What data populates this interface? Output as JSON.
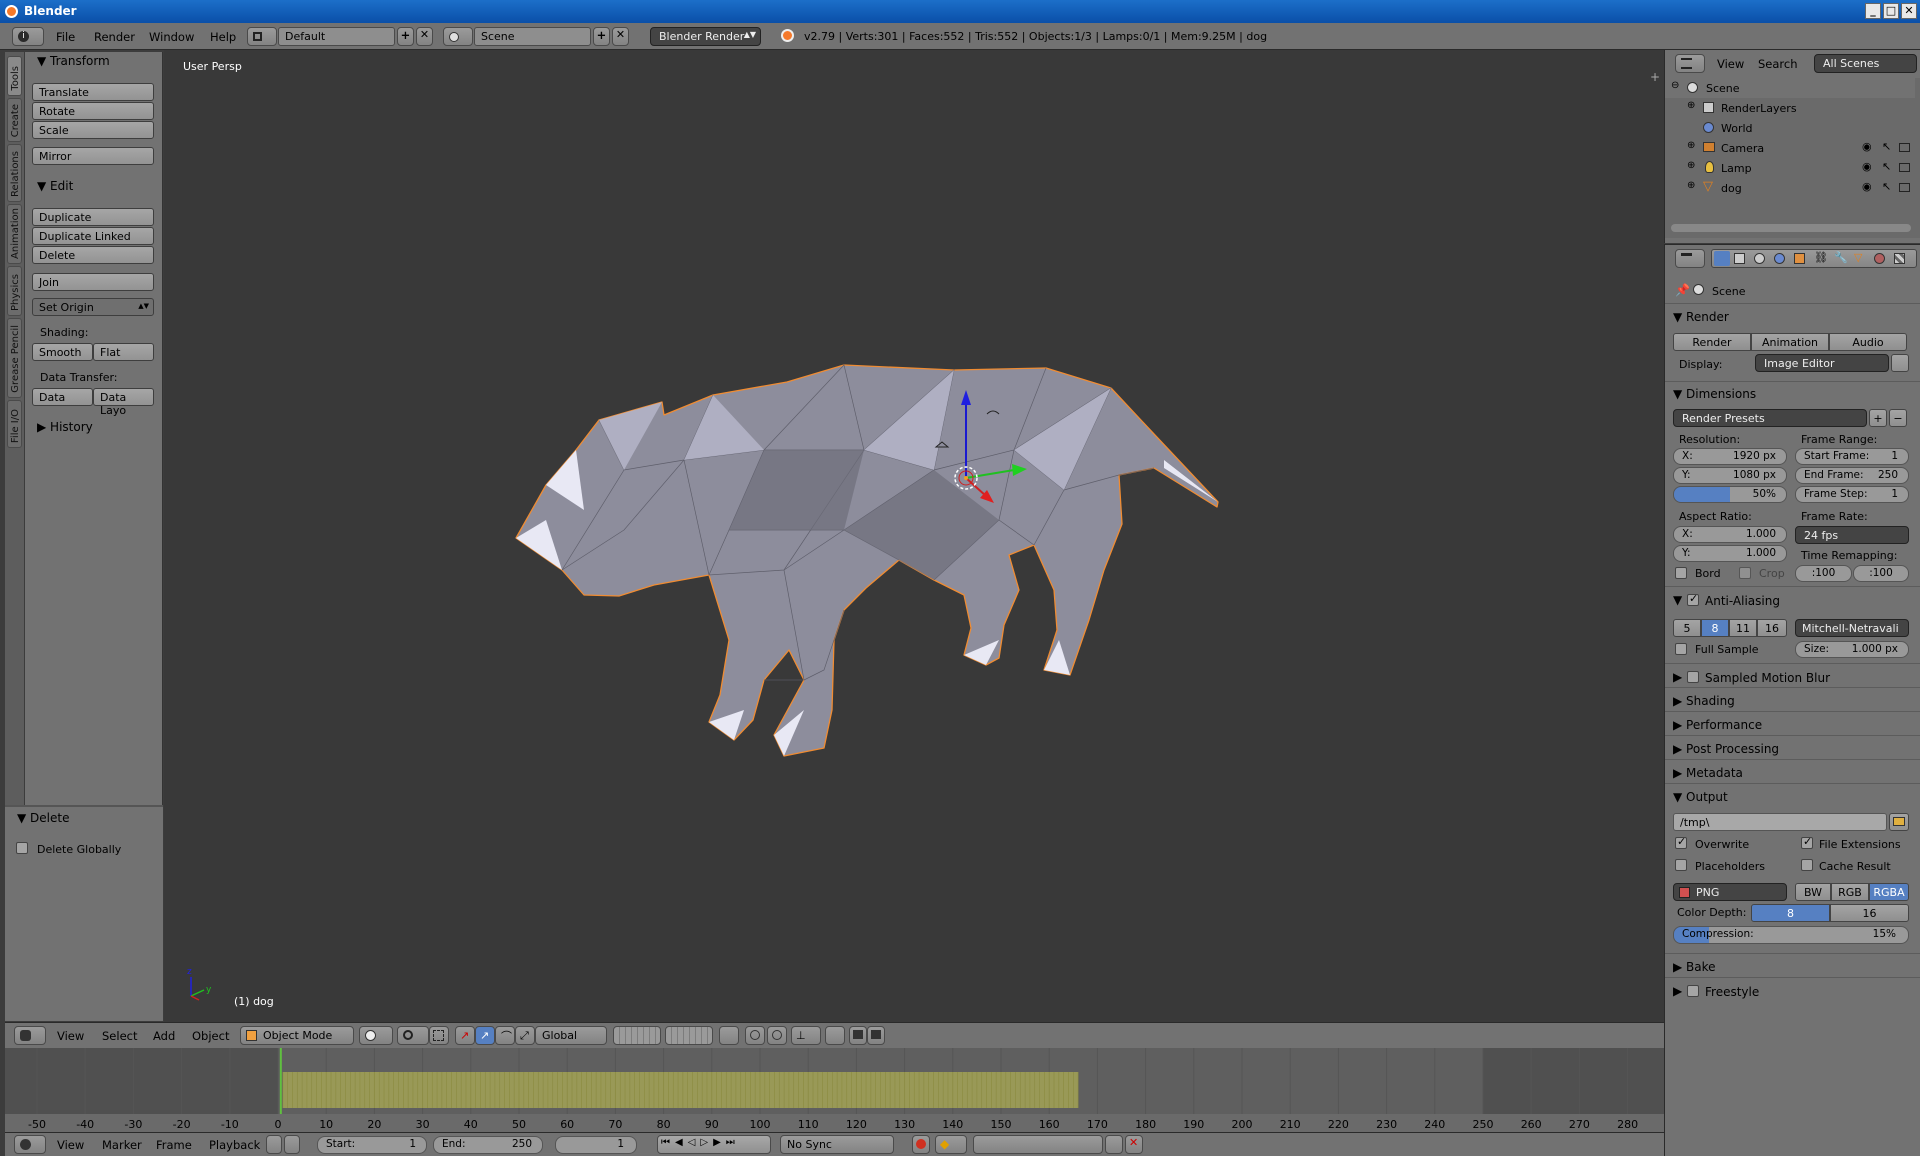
{
  "window": {
    "title": "Blender",
    "btn_min": "_",
    "btn_max": "□",
    "btn_close": "✕"
  },
  "info_header": {
    "menus": [
      "File",
      "Render",
      "Window",
      "Help"
    ],
    "layout": "Default",
    "scene": "Scene",
    "engine": "Blender Render",
    "stats": "v2.79 | Verts:301 | Faces:552 | Tris:552 | Objects:1/3 | Lamps:0/1 | Mem:9.25M | dog"
  },
  "tool_tabs": [
    "Tools",
    "Create",
    "Relations",
    "Animation",
    "Physics",
    "Grease Pencil",
    "File I/O"
  ],
  "tool_shelf": {
    "transform_title": "Transform",
    "translate": "Translate",
    "rotate": "Rotate",
    "scale": "Scale",
    "mirror": "Mirror",
    "edit_title": "Edit",
    "duplicate": "Duplicate",
    "duplicate_linked": "Duplicate Linked",
    "delete": "Delete",
    "join": "Join",
    "set_origin": "Set Origin",
    "shading_label": "Shading:",
    "smooth": "Smooth",
    "flat": "Flat",
    "data_transfer_label": "Data Transfer:",
    "data": "Data",
    "data_layout": "Data Layo",
    "history_title": "History"
  },
  "operator_panel": {
    "title": "Delete",
    "delete_globally": "Delete Globally"
  },
  "viewport": {
    "view_label": "User Persp",
    "object_label": "(1) dog"
  },
  "view3d_header": {
    "menus": [
      "View",
      "Select",
      "Add",
      "Object"
    ],
    "mode": "Object Mode",
    "orientation": "Global"
  },
  "timeline": {
    "ticks": [
      "-50",
      "-40",
      "-30",
      "-20",
      "-10",
      "0",
      "10",
      "20",
      "30",
      "40",
      "50",
      "60",
      "70",
      "80",
      "90",
      "100",
      "110",
      "120",
      "130",
      "140",
      "150",
      "160",
      "170",
      "180",
      "190",
      "200",
      "210",
      "220",
      "230",
      "240",
      "250",
      "260",
      "270",
      "280"
    ],
    "menus": [
      "View",
      "Marker",
      "Frame",
      "Playback"
    ],
    "start_label": "Start:",
    "start_value": "1",
    "end_label": "End:",
    "end_value": "250",
    "current_frame": "1",
    "sync": "No Sync"
  },
  "outliner": {
    "menus": [
      "View",
      "Search"
    ],
    "filter": "All Scenes",
    "items": [
      "Scene",
      "RenderLayers",
      "World",
      "Camera",
      "Lamp",
      "dog"
    ]
  },
  "properties": {
    "context": "Scene",
    "render_title": "Render",
    "render_btn": "Render",
    "animation_btn": "Animation",
    "audio_btn": "Audio",
    "display_label": "Display:",
    "display_value": "Image Editor",
    "dimensions_title": "Dimensions",
    "render_presets": "Render Presets",
    "resolution_label": "Resolution:",
    "res_x": "X:",
    "res_x_val": "1920 px",
    "res_y": "Y:",
    "res_y_val": "1080 px",
    "res_pct": "50%",
    "frame_range_label": "Frame Range:",
    "start_frame": "Start Frame:",
    "start_frame_val": "1",
    "end_frame": "End Frame:",
    "end_frame_val": "250",
    "frame_step": "Frame Step:",
    "frame_step_val": "1",
    "aspect_label": "Aspect Ratio:",
    "asp_x": "X:",
    "asp_x_val": "1.000",
    "asp_y": "Y:",
    "asp_y_val": "1.000",
    "frame_rate_label": "Frame Rate:",
    "frame_rate_val": "24 fps",
    "time_remap_label": "Time Remapping:",
    "remap_old": ":100",
    "remap_new": ":100",
    "bord": "Bord",
    "crop": "Crop",
    "aa_title": "Anti-Aliasing",
    "aa_samples": [
      "5",
      "8",
      "11",
      "16"
    ],
    "aa_filter": "Mitchell-Netravali",
    "full_sample": "Full Sample",
    "size_label": "Size:",
    "size_val": "1.000 px",
    "sampled_motion_blur": "Sampled Motion Blur",
    "shading": "Shading",
    "performance": "Performance",
    "post_processing": "Post Processing",
    "metadata": "Metadata",
    "output_title": "Output",
    "output_path": "/tmp\\",
    "overwrite": "Overwrite",
    "file_extensions": "File Extensions",
    "placeholders": "Placeholders",
    "cache_result": "Cache Result",
    "format": "PNG",
    "bw": "BW",
    "rgb": "RGB",
    "rgba": "RGBA",
    "color_depth_label": "Color Depth:",
    "depth_8": "8",
    "depth_16": "16",
    "compression_label": "Compression:",
    "compression_val": "15%",
    "bake": "Bake",
    "freestyle": "Freestyle"
  },
  "colors": {
    "selection": "#5680c2",
    "mesh": "#8f8f9e",
    "outline": "#f08c32",
    "playhead": "#60c040",
    "keyframes": "#c8c850"
  }
}
